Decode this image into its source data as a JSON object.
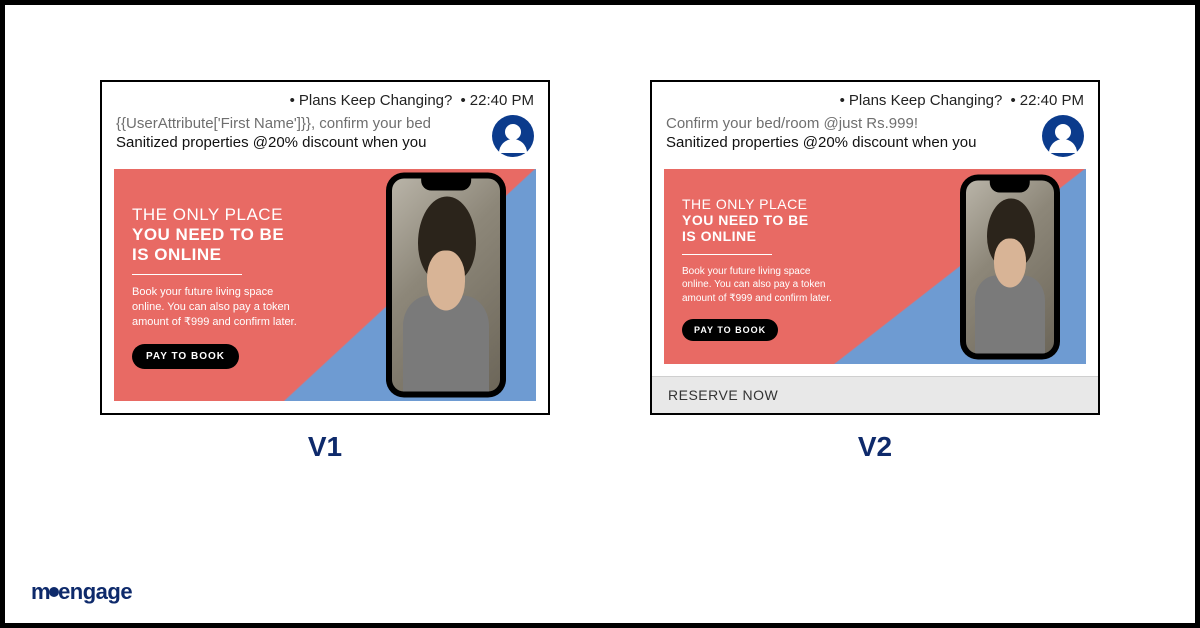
{
  "brand": "moengage",
  "variants": {
    "v1": {
      "label": "V1",
      "meta_title": "Plans Keep Changing?",
      "meta_time": "22:40 PM",
      "notif_title": "{{UserAttribute['First Name']}}, confirm your bed",
      "notif_body": "Sanitized properties @20% discount when you",
      "headline_line1": "THE ONLY PLACE",
      "headline_line2": "YOU NEED TO BE",
      "headline_line3": "IS ONLINE",
      "copy": "Book your future living space online. You can also pay a token amount of ₹999 and confirm later.",
      "cta": "PAY TO BOOK"
    },
    "v2": {
      "label": "V2",
      "meta_title": "Plans Keep Changing?",
      "meta_time": "22:40 PM",
      "notif_title": "Confirm your bed/room @just Rs.999!",
      "notif_body": "Sanitized properties @20% discount when you",
      "headline_line1": "THE ONLY PLACE",
      "headline_line2": "YOU NEED TO BE",
      "headline_line3": "IS ONLINE",
      "copy": "Book your future living space online. You can also pay a token amount of ₹999 and confirm later.",
      "cta": "PAY TO BOOK",
      "action": "RESERVE NOW"
    }
  }
}
